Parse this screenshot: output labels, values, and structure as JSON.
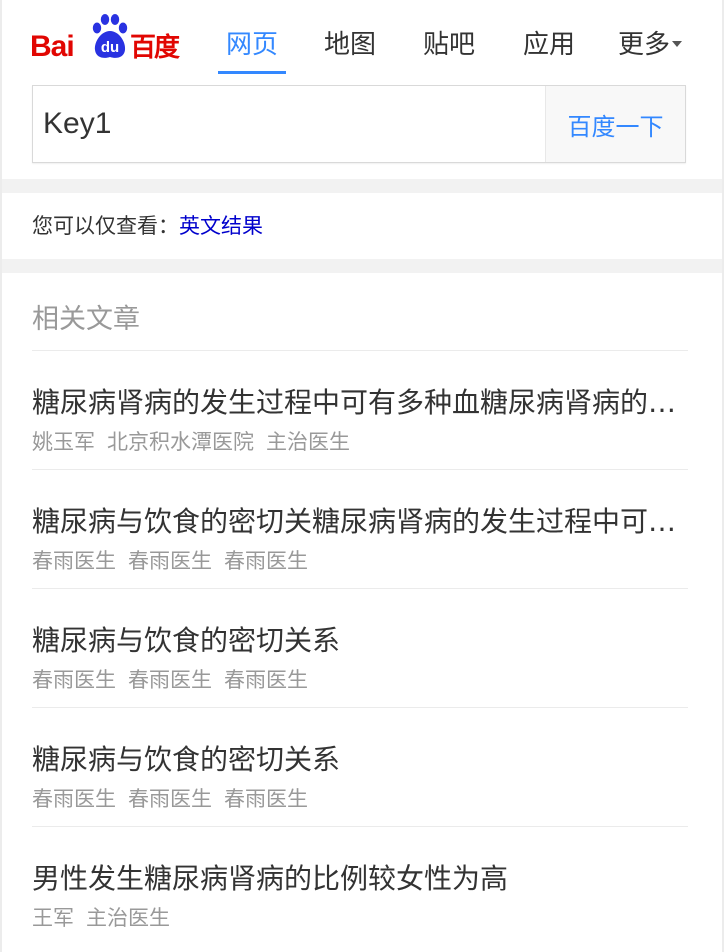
{
  "logo": {
    "latin_text": "Bai",
    "paw_text": "du",
    "chinese_text": "百度",
    "colors": {
      "red": "#e10602",
      "blue": "#2932e1"
    }
  },
  "nav": {
    "tabs": [
      {
        "label": "网页",
        "active": true
      },
      {
        "label": "地图",
        "active": false
      },
      {
        "label": "贴吧",
        "active": false
      },
      {
        "label": "应用",
        "active": false
      },
      {
        "label": "更多",
        "active": false
      }
    ],
    "more_icon": "caret-down-icon"
  },
  "search": {
    "value": "Key1",
    "button_label": "百度一下"
  },
  "hint": {
    "prefix": "您可以仅查看：",
    "link": "英文结果"
  },
  "related": {
    "title": "相关文章",
    "articles": [
      {
        "title": "糖尿病肾病的发生过程中可有多种血糖尿病肾病的发生过程中可有多种血",
        "meta": [
          "姚玉军",
          "北京积水潭医院",
          "主治医生"
        ]
      },
      {
        "title": "糖尿病与饮食的密切关糖尿病肾病的发生过程中可有多种",
        "meta": [
          "春雨医生",
          "春雨医生",
          "春雨医生"
        ]
      },
      {
        "title": "糖尿病与饮食的密切关系",
        "meta": [
          "春雨医生",
          "春雨医生",
          "春雨医生"
        ]
      },
      {
        "title": "糖尿病与饮食的密切关系",
        "meta": [
          "春雨医生",
          "春雨医生",
          "春雨医生"
        ]
      },
      {
        "title": "男性发生糖尿病肾病的比例较女性为高",
        "meta": [
          "王军",
          "主治医生"
        ]
      }
    ]
  },
  "colors": {
    "accent": "#3388ff",
    "link": "#0000cc",
    "text": "#333333",
    "muted": "#999999",
    "separator": "#f2f2f2"
  }
}
